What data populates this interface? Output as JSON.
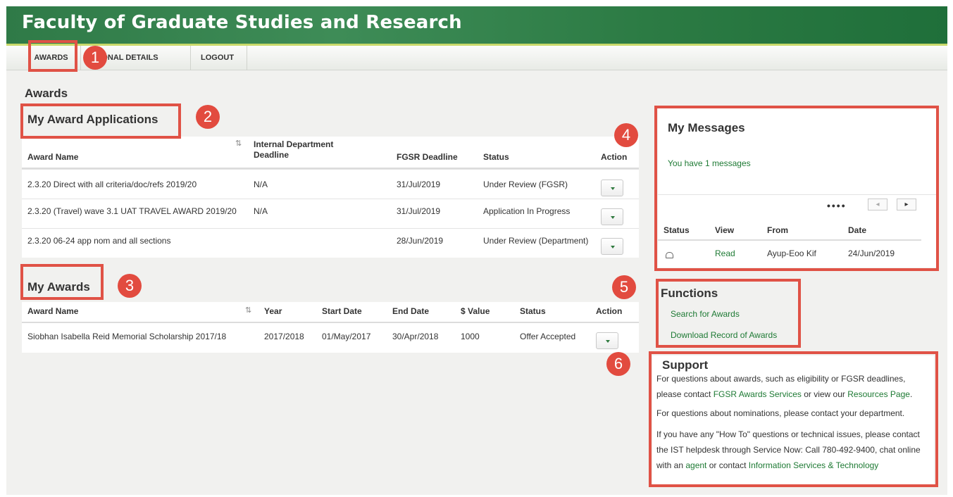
{
  "header": {
    "title": "Faculty of Graduate Studies and Research"
  },
  "nav": {
    "awards": "AWARDS",
    "personal_details": "SONAL DETAILS",
    "logout": "LOGOUT"
  },
  "page_title": "Awards",
  "badges": [
    "1",
    "2",
    "3",
    "4",
    "5",
    "6"
  ],
  "applications": {
    "title": "My Award Applications",
    "columns": {
      "award_name": "Award Name",
      "internal_deadline": "Internal Department Deadline",
      "fgsr_deadline": "FGSR Deadline",
      "status": "Status",
      "action": "Action"
    },
    "rows": [
      {
        "award_name": "2.3.20 Direct with all criteria/doc/refs 2019/20",
        "internal_deadline": "N/A",
        "fgsr_deadline": "31/Jul/2019",
        "status": "Under Review (FGSR)"
      },
      {
        "award_name": "2.3.20 (Travel) wave 3.1 UAT TRAVEL AWARD 2019/20",
        "internal_deadline": "N/A",
        "fgsr_deadline": "31/Jul/2019",
        "status": "Application In Progress"
      },
      {
        "award_name": "2.3.20 06-24 app nom and all sections",
        "internal_deadline": "",
        "fgsr_deadline": "28/Jun/2019",
        "status": "Under Review (Department)"
      }
    ]
  },
  "awards": {
    "title": "My Awards",
    "columns": {
      "award_name": "Award Name",
      "year": "Year",
      "start_date": "Start Date",
      "end_date": "End Date",
      "value": "$ Value",
      "status": "Status",
      "action": "Action"
    },
    "rows": [
      {
        "award_name": "Siobhan Isabella Reid Memorial Scholarship 2017/18",
        "year": "2017/2018",
        "start_date": "01/May/2017",
        "end_date": "30/Apr/2018",
        "value": "1000",
        "status": "Offer Accepted"
      }
    ]
  },
  "messages": {
    "title": "My Messages",
    "summary": "You have 1 messages",
    "pager_dots": "••••",
    "columns": {
      "status": "Status",
      "view": "View",
      "from": "From",
      "date": "Date"
    },
    "rows": [
      {
        "view": "Read",
        "from": "Ayup-Eoo Kif",
        "date": "24/Jun/2019"
      }
    ]
  },
  "functions": {
    "title": "Functions",
    "links": [
      "Search for Awards",
      "Download Record of Awards"
    ]
  },
  "support": {
    "title": "Support",
    "p1_pre": "For questions about awards, such as eligibility or FGSR deadlines, please contact ",
    "p1_link1": "FGSR Awards Services",
    "p1_mid": " or view our ",
    "p1_link2": "Resources Page",
    "p1_post": ".",
    "p2": "For questions about nominations, please contact your department.",
    "p3_pre": "If you have any \"How To\" questions or technical issues, please contact the IST helpdesk through Service Now: Call 780-492-9400, chat online with an ",
    "p3_link1": "agent",
    "p3_mid": " or contact ",
    "p3_link2": "Information Services & Technology"
  },
  "colors": {
    "banner_green": "#2f7a47",
    "link_green": "#1e7a34",
    "annotation_red": "#e05246"
  }
}
